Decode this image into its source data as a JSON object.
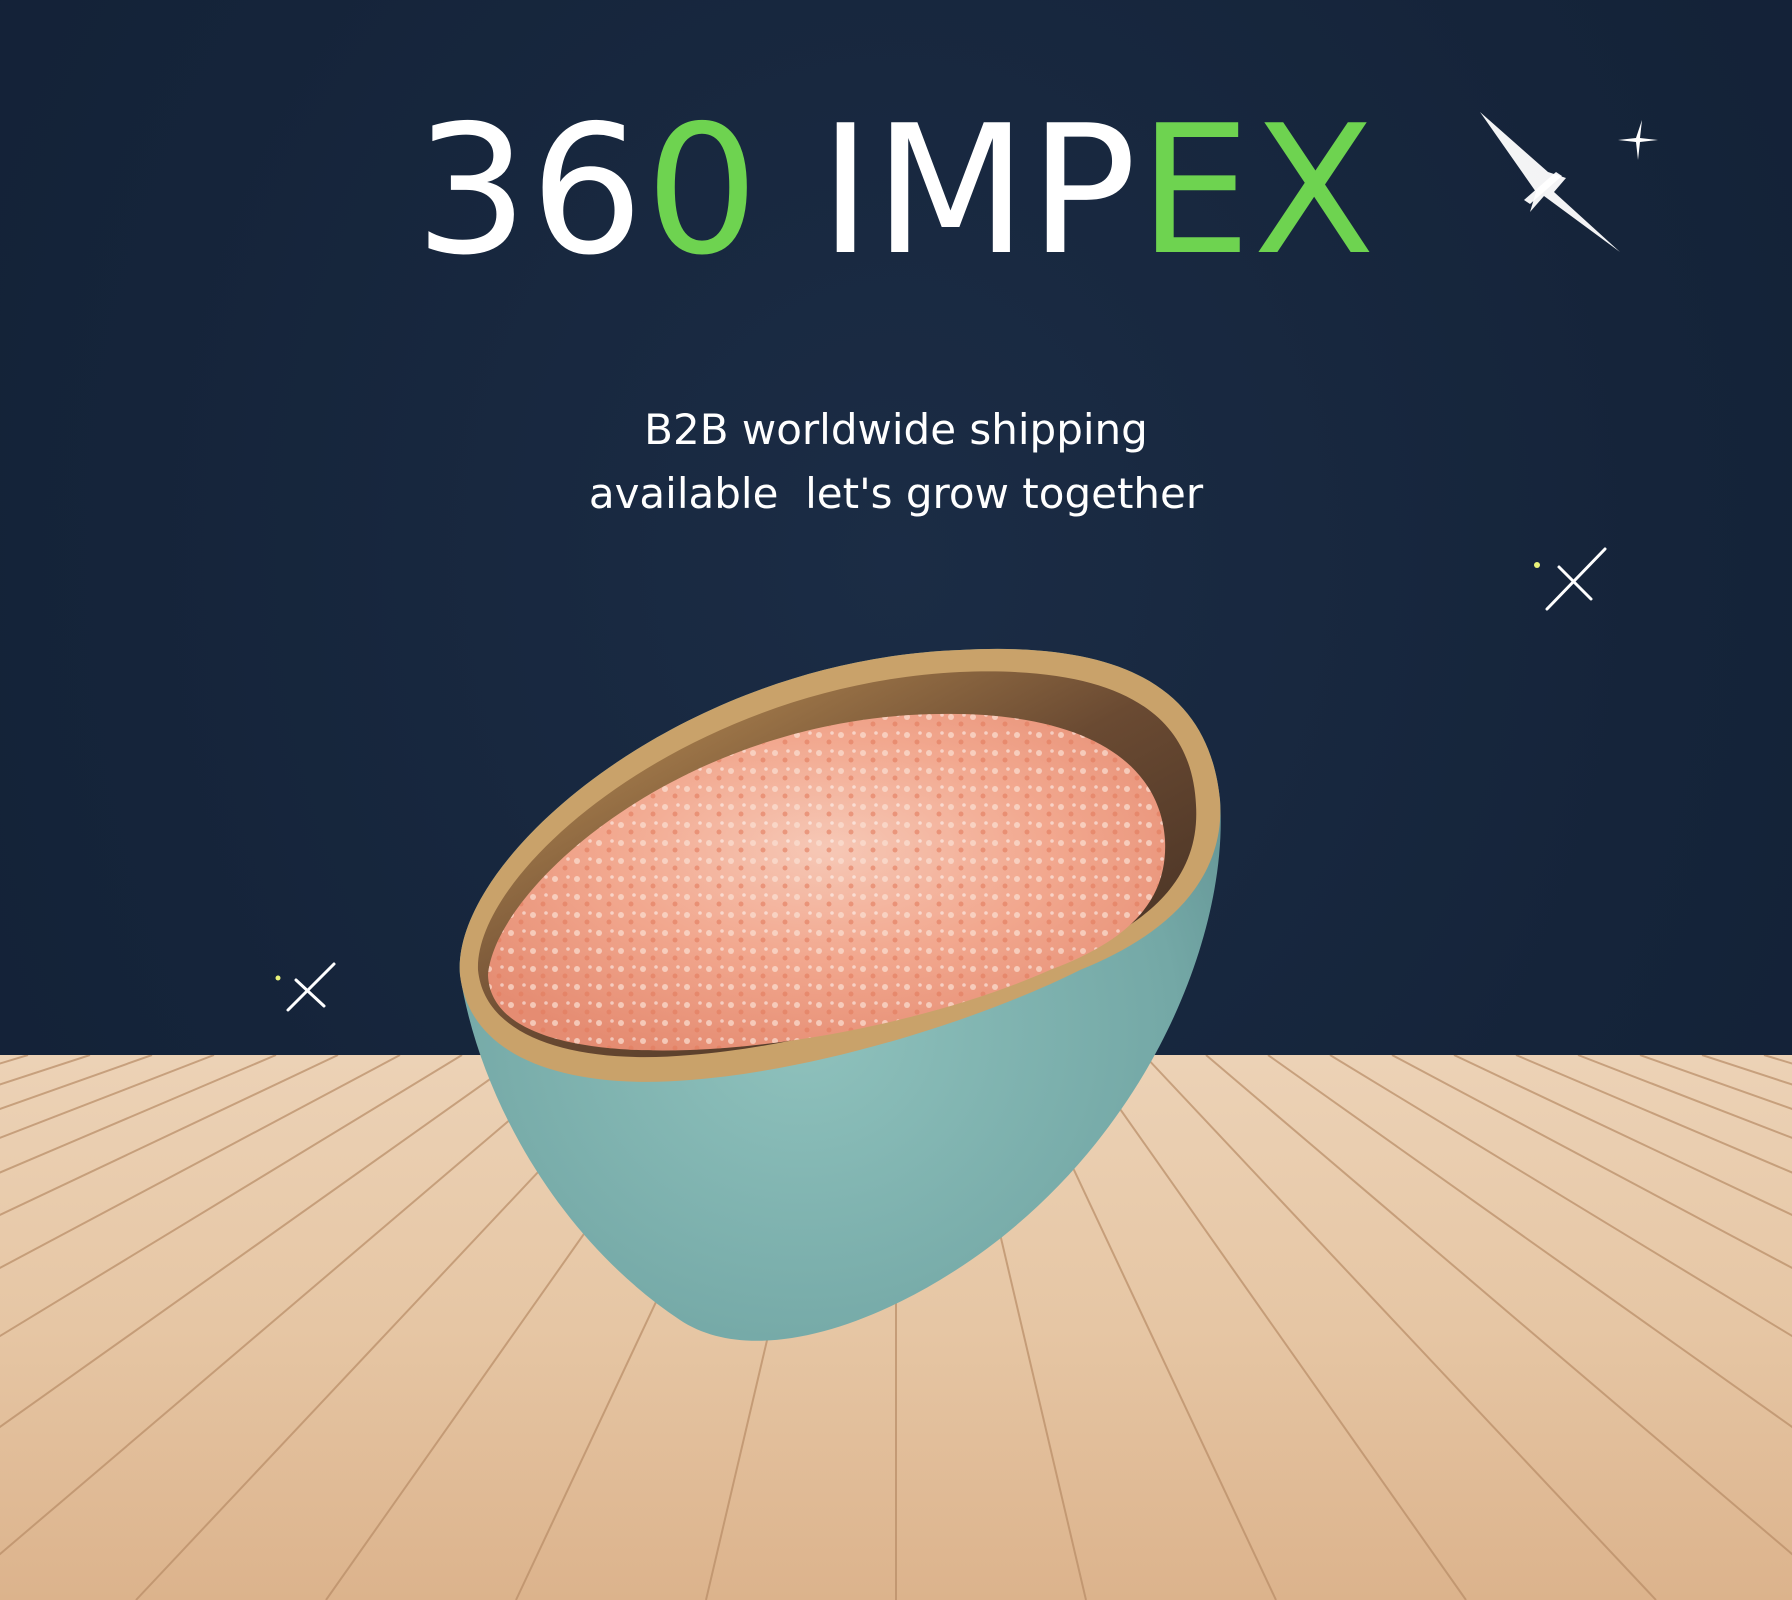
{
  "brand": {
    "logo_parts": [
      {
        "text": "36",
        "color": "#ffffff"
      },
      {
        "text": "0",
        "color": "#6ed350"
      },
      {
        "text": " IMP",
        "color": "#ffffff"
      },
      {
        "text": "EX",
        "color": "#6ed350"
      }
    ]
  },
  "tagline": {
    "line1": "B2B worldwide shipping",
    "line2": "available  let's grow together"
  },
  "colors": {
    "background": "#16263d",
    "accent_green": "#6ed350",
    "wood": "#e8c9a8",
    "bowl": "#7fb0ad",
    "salt": "#f0a08a"
  },
  "icons": [
    "sparkle-icon",
    "sparkle-icon",
    "sparkle-icon",
    "sparkle-icon"
  ]
}
